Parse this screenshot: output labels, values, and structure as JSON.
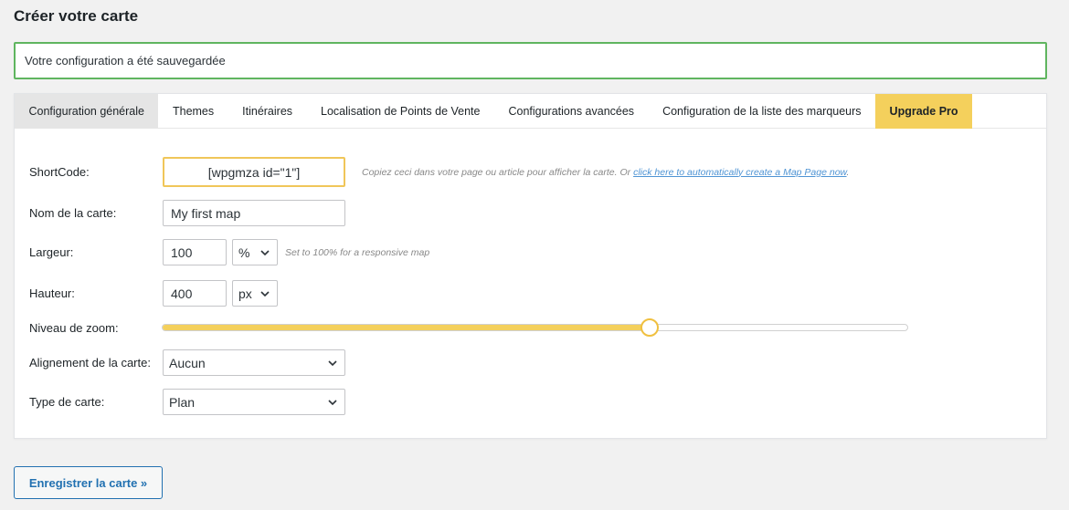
{
  "page": {
    "title": "Créer votre carte"
  },
  "notice": {
    "text": "Votre configuration a été sauvegardée"
  },
  "tabs": [
    {
      "label": "Configuration générale"
    },
    {
      "label": "Themes"
    },
    {
      "label": "Itinéraires"
    },
    {
      "label": "Localisation de Points de Vente"
    },
    {
      "label": "Configurations avancées"
    },
    {
      "label": "Configuration de la liste des marqueurs"
    },
    {
      "label": "Upgrade Pro"
    }
  ],
  "form": {
    "shortcode": {
      "label": "ShortCode:",
      "value": "[wpgmza id=\"1\"]",
      "hint": "Copiez ceci dans votre page ou article pour afficher la carte. Or",
      "hint_link": "click here to automatically create a Map Page now"
    },
    "name": {
      "label": "Nom de la carte:",
      "value": "My first map"
    },
    "width": {
      "label": "Largeur:",
      "value": "100",
      "unit": "%",
      "hint": "Set to 100% for a responsive map"
    },
    "height": {
      "label": "Hauteur:",
      "value": "400",
      "unit": "px"
    },
    "zoom": {
      "label": "Niveau de zoom:",
      "fraction": 0.654
    },
    "alignment": {
      "label": "Alignement de la carte:",
      "value": "Aucun"
    },
    "type": {
      "label": "Type de carte:",
      "value": "Plan"
    }
  },
  "save_button": {
    "label": "Enregistrer la carte »"
  },
  "colors": {
    "accent": "#f4d05c",
    "link": "#2271b1",
    "notice_border": "#5fb55f"
  },
  "icons": {
    "select_arrow": "chevron-down-icon"
  }
}
